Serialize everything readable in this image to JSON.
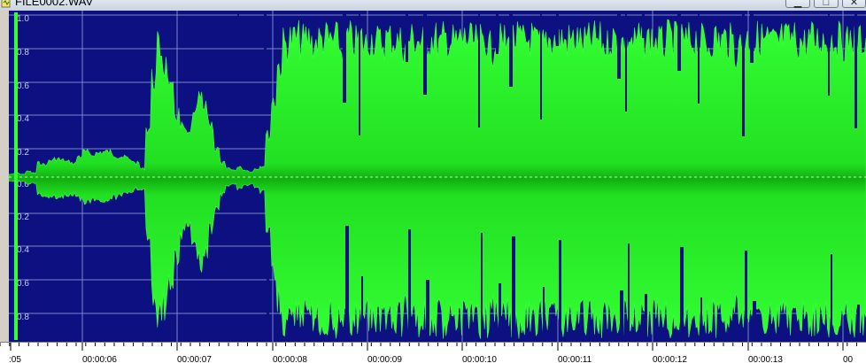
{
  "window": {
    "title": "FILE0002.WAV",
    "buttons": {
      "minimize": "▁",
      "maximize": "□",
      "close": "✕"
    }
  },
  "colors": {
    "background": "#0c1080",
    "waveform": "#33ff33",
    "grid": "#7a86c8",
    "zero_line": "#ffffff",
    "amp_label": "#c6cdf0"
  },
  "waveform": {
    "amplitude_labels": [
      "1.0",
      "0.8",
      "0.6",
      "0.4",
      "0.2",
      "0.0",
      "0.2",
      "0.4",
      "0.6",
      "0.8"
    ],
    "envelope_top": [
      0.02,
      0.03,
      0.02,
      0.04,
      0.03,
      0.1,
      0.09,
      0.12,
      0.13,
      0.12,
      0.11,
      0.1,
      0.15,
      0.18,
      0.16,
      0.17,
      0.18,
      0.18,
      0.16,
      0.15,
      0.14,
      0.12,
      0.1,
      0.06,
      0.35,
      0.7,
      0.92,
      0.8,
      0.6,
      0.45,
      0.35,
      0.3,
      0.42,
      0.55,
      0.48,
      0.38,
      0.2,
      0.1,
      0.06,
      0.05,
      0.07,
      0.05,
      0.04,
      0.06,
      0.08,
      0.3,
      0.55,
      0.8,
      0.95,
      0.98,
      0.99,
      0.97,
      0.99,
      0.96,
      0.98,
      0.99,
      0.97,
      0.98,
      0.9,
      0.99,
      0.96,
      0.99,
      0.95,
      0.99,
      0.97,
      0.96,
      0.99,
      0.98,
      0.97,
      0.93,
      0.99,
      0.98,
      0.96,
      0.98,
      0.99,
      0.95,
      0.99,
      0.97,
      0.96,
      0.99,
      0.99,
      0.96,
      0.98,
      0.99,
      0.92,
      0.99,
      0.97,
      0.95,
      0.99,
      0.98,
      0.97,
      0.99,
      0.96,
      0.95,
      0.99,
      0.98,
      0.99,
      0.97,
      0.98,
      0.99,
      0.96,
      0.97,
      0.99,
      0.98,
      0.94,
      0.99,
      0.98,
      0.97,
      0.99,
      0.96,
      0.99,
      0.98,
      0.99,
      0.97,
      0.95,
      0.99,
      0.98,
      0.99,
      0.96,
      0.98,
      0.99,
      0.97,
      0.95,
      0.99,
      0.98,
      0.99,
      0.97,
      0.9,
      0.98,
      0.99,
      0.96,
      0.99,
      0.98,
      0.97,
      0.95,
      0.99,
      0.98,
      0.99,
      0.97,
      0.96,
      0.99,
      0.98,
      0.99,
      0.97,
      0.99,
      0.98,
      0.96,
      0.99,
      0.97,
      0.98,
      0.99
    ],
    "envelope_bottom": [
      0.03,
      0.02,
      0.03,
      0.05,
      0.04,
      0.12,
      0.13,
      0.14,
      0.14,
      0.13,
      0.12,
      0.12,
      0.15,
      0.17,
      0.16,
      0.18,
      0.16,
      0.15,
      0.14,
      0.12,
      0.11,
      0.1,
      0.08,
      0.08,
      0.4,
      0.85,
      0.95,
      0.88,
      0.7,
      0.55,
      0.4,
      0.35,
      0.48,
      0.6,
      0.5,
      0.35,
      0.22,
      0.12,
      0.06,
      0.05,
      0.08,
      0.06,
      0.05,
      0.07,
      0.1,
      0.35,
      0.65,
      0.85,
      0.99,
      0.98,
      0.99,
      0.97,
      0.99,
      0.99,
      0.98,
      0.99,
      0.97,
      0.99,
      0.93,
      0.99,
      0.97,
      0.99,
      0.96,
      0.99,
      0.98,
      0.97,
      0.99,
      0.99,
      0.98,
      0.95,
      0.99,
      0.98,
      0.97,
      0.99,
      0.99,
      0.96,
      0.99,
      0.98,
      0.97,
      0.99,
      0.99,
      0.97,
      0.99,
      0.99,
      0.94,
      0.99,
      0.98,
      0.96,
      0.99,
      0.99,
      0.98,
      0.99,
      0.97,
      0.96,
      0.99,
      0.99,
      0.99,
      0.98,
      0.99,
      0.99,
      0.97,
      0.98,
      0.99,
      0.99,
      0.95,
      0.99,
      0.99,
      0.98,
      0.99,
      0.97,
      0.99,
      0.99,
      0.99,
      0.98,
      0.96,
      0.99,
      0.99,
      0.99,
      0.97,
      0.99,
      0.99,
      0.98,
      0.96,
      0.99,
      0.99,
      0.99,
      0.98,
      0.92,
      0.99,
      0.99,
      0.97,
      0.99,
      0.99,
      0.98,
      0.96,
      0.99,
      0.99,
      0.99,
      0.98,
      0.97,
      0.99,
      0.99,
      0.99,
      0.98,
      0.99,
      0.99,
      0.97,
      0.99,
      0.98,
      0.99,
      0.99
    ]
  },
  "timeline": {
    "labels": [
      ":05",
      "00:00:06",
      "00:00:07",
      "00:00:08",
      "00:00:09",
      "00:00:10",
      "00:00:11",
      "00:00:12",
      "00:00:13",
      "00"
    ]
  }
}
